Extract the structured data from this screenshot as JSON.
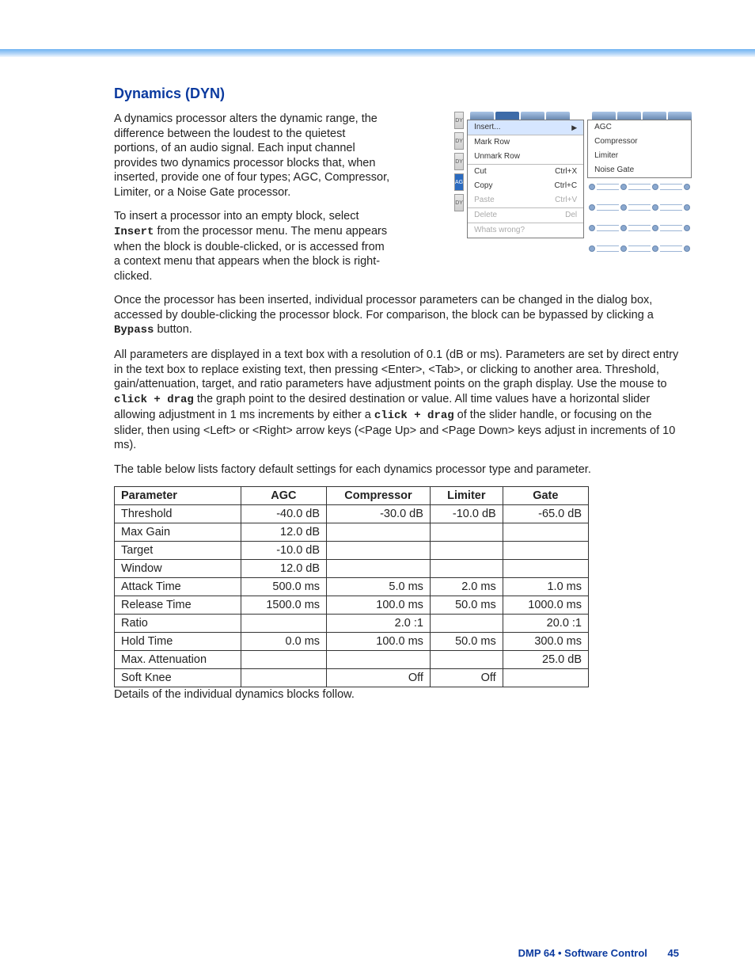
{
  "section_title": "Dynamics (DYN)",
  "figure": {
    "left_strip": [
      "DY",
      "DY",
      "DY",
      "AG",
      "DY"
    ],
    "left_strip_selected_index": 3,
    "menu_left": [
      {
        "label": "Insert...",
        "highlight": true,
        "arrow": true,
        "shortcut": ""
      },
      {
        "label": "Mark Row",
        "sep_above": true,
        "shortcut": ""
      },
      {
        "label": "Unmark Row",
        "shortcut": ""
      },
      {
        "label": "Cut",
        "sep_above": true,
        "shortcut": "Ctrl+X"
      },
      {
        "label": "Copy",
        "shortcut": "Ctrl+C"
      },
      {
        "label": "Paste",
        "shortcut": "Ctrl+V",
        "disabled": true
      },
      {
        "label": "Delete",
        "sep_above": true,
        "shortcut": "Del",
        "disabled": true
      },
      {
        "label": "Whats wrong?",
        "sep_above": true,
        "shortcut": "",
        "disabled": true
      }
    ],
    "menu_right": [
      {
        "label": "AGC"
      },
      {
        "label": "Compressor"
      },
      {
        "label": "Limiter"
      },
      {
        "label": "Noise Gate"
      }
    ]
  },
  "paragraphs": {
    "p1": "A dynamics processor alters the dynamic range, the difference between the loudest to the quietest portions, of an audio signal. Each input channel provides two dynamics processor blocks that, when inserted, provide one of four types; AGC, Compressor, Limiter, or a Noise Gate processor.",
    "p2_a": "To insert a processor into an empty block, select ",
    "p2_insert": "Insert",
    "p2_b": " from the processor menu. The menu appears when the block is double-clicked, or is accessed from a context menu that appears when the block is right-clicked.",
    "p3": "Once the processor has been inserted, individual processor parameters can be changed in the dialog box, accessed by double-clicking the processor block. For comparison, the block can be bypassed by clicking a ",
    "p3_bypass": "Bypass",
    "p3_b": " button.",
    "p4_a": "All parameters are displayed in a text box with a resolution of 0.1 (dB or ms). Parameters are set by direct entry in the text box to replace existing text, then pressing <Enter>, <Tab>, or clicking to another area. Threshold, gain/attenuation, target, and ratio parameters have adjustment points on the graph display. Use the mouse to ",
    "p4_cd1": "click + drag",
    "p4_b": " the graph point to the desired destination or value. All time values have a horizontal slider allowing adjustment in 1 ms increments by either a ",
    "p4_cd2": "click + drag",
    "p4_c": " of the slider handle, or focusing on the slider, then using <Left> or <Right> arrow keys (<Page Up> and <Page Down> keys adjust in increments of 10 ms).",
    "p5": "The table below lists factory default settings for each dynamics processor type and parameter.",
    "after_table": "Details of the individual dynamics blocks follow."
  },
  "table": {
    "headers": [
      "Parameter",
      "AGC",
      "Compressor",
      "Limiter",
      "Gate"
    ],
    "rows": [
      {
        "name": "Threshold",
        "vals": [
          "-40.0 dB",
          "-30.0 dB",
          "-10.0 dB",
          "-65.0 dB"
        ]
      },
      {
        "name": "Max Gain",
        "vals": [
          "12.0 dB",
          "",
          "",
          ""
        ]
      },
      {
        "name": "Target",
        "vals": [
          "-10.0 dB",
          "",
          "",
          ""
        ]
      },
      {
        "name": "Window",
        "vals": [
          "12.0 dB",
          "",
          "",
          ""
        ]
      },
      {
        "name": "Attack Time",
        "vals": [
          "500.0 ms",
          "5.0 ms",
          "2.0 ms",
          "1.0 ms"
        ]
      },
      {
        "name": "Release Time",
        "vals": [
          "1500.0 ms",
          "100.0 ms",
          "50.0 ms",
          "1000.0 ms"
        ]
      },
      {
        "name": "Ratio",
        "vals": [
          "",
          "2.0 :1",
          "",
          "20.0 :1"
        ]
      },
      {
        "name": "Hold Time",
        "vals": [
          "0.0 ms",
          "100.0 ms",
          "50.0 ms",
          "300.0 ms"
        ]
      },
      {
        "name": "Max. Attenuation",
        "vals": [
          "",
          "",
          "",
          "25.0 dB"
        ]
      },
      {
        "name": "Soft Knee",
        "vals": [
          "",
          "Off",
          "Off",
          ""
        ]
      }
    ]
  },
  "footer": {
    "title": "DMP 64 • Software Control",
    "page": "45"
  }
}
